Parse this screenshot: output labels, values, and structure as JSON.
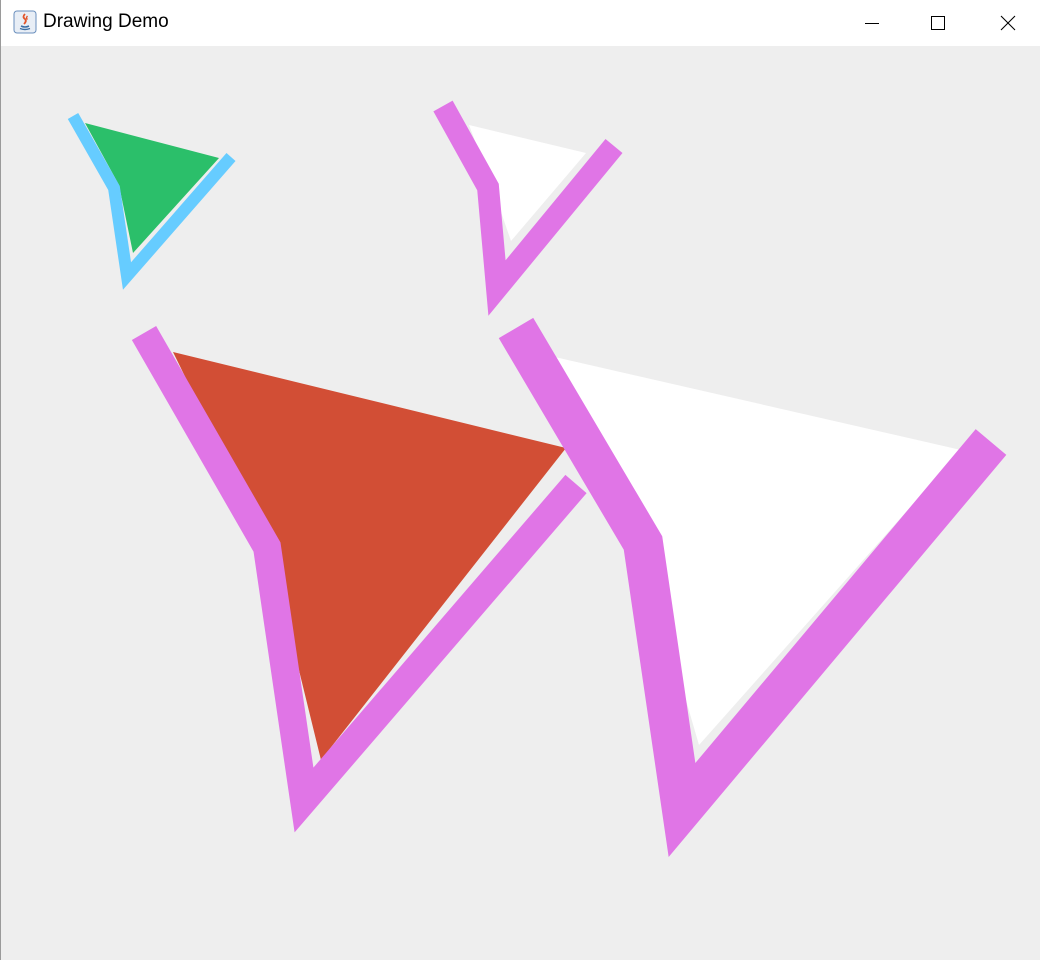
{
  "window": {
    "title": "Drawing Demo",
    "controls": {
      "minimize": "minimize-icon",
      "maximize": "maximize-icon",
      "close": "close-icon"
    }
  },
  "canvas": {
    "background": "#eeeeee",
    "shapes": [
      {
        "name": "small-green-shape",
        "fill": "#2bbf6a",
        "stroke": "#66ccff"
      },
      {
        "name": "small-white-shape",
        "fill": "#ffffff",
        "stroke": "#e075e6"
      },
      {
        "name": "large-red-shape",
        "fill": "#d24e35",
        "stroke": "#e075e6"
      },
      {
        "name": "large-white-shape",
        "fill": "#ffffff",
        "stroke": "#e075e6"
      }
    ]
  }
}
